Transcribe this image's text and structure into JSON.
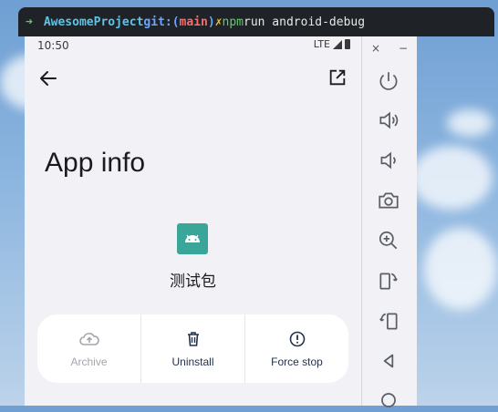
{
  "terminal": {
    "arrow": "➜",
    "project": "AwesomeProject",
    "git_label": "git:(",
    "branch": "main",
    "git_close": ")",
    "dirty": "✗",
    "cmd_npm": "npm",
    "cmd_rest": "run android-debug"
  },
  "status": {
    "time": "10:50",
    "network": "LTE"
  },
  "page": {
    "title": "App info",
    "app_name": "测试包"
  },
  "actions": [
    {
      "label": "Archive",
      "icon": "cloud-upload-icon",
      "enabled": false
    },
    {
      "label": "Uninstall",
      "icon": "trash-icon",
      "enabled": true
    },
    {
      "label": "Force stop",
      "icon": "alert-circle-icon",
      "enabled": true
    }
  ],
  "emulator_toolbar": {
    "window_controls": [
      "×",
      "−"
    ],
    "buttons": [
      "power-icon",
      "volume-up-icon",
      "volume-down-icon",
      "camera-icon",
      "zoom-in-icon",
      "rotate-left-icon",
      "rotate-right-icon",
      "back-icon",
      "home-icon"
    ]
  },
  "colors": {
    "accent": "#3aa599",
    "action_text": "#24324a",
    "disabled_text": "#a4a6ad"
  }
}
